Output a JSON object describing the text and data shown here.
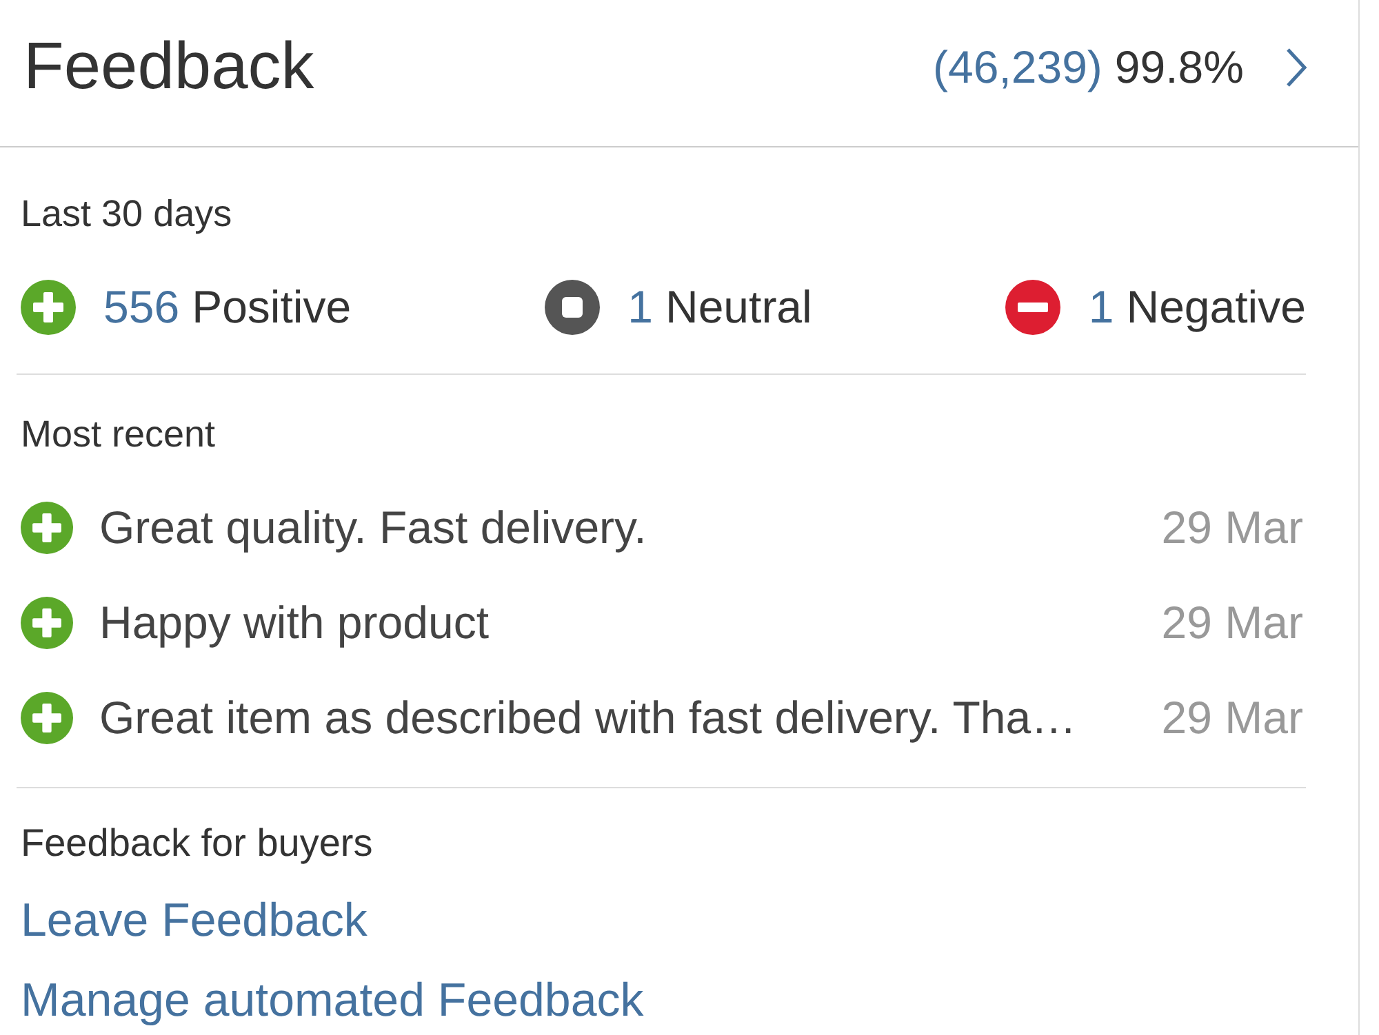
{
  "header": {
    "title": "Feedback",
    "count": "(46,239)",
    "percentage": "99.8%"
  },
  "summary": {
    "label": "Last 30 days",
    "ratings": [
      {
        "kind": "positive",
        "count": "556",
        "label": "Positive"
      },
      {
        "kind": "neutral",
        "count": "1",
        "label": "Neutral"
      },
      {
        "kind": "negative",
        "count": "1",
        "label": "Negative"
      }
    ]
  },
  "recent": {
    "label": "Most recent",
    "items": [
      {
        "kind": "positive",
        "text": "Great quality. Fast delivery.",
        "date": "29 Mar"
      },
      {
        "kind": "positive",
        "text": "Happy with product",
        "date": "29 Mar"
      },
      {
        "kind": "positive",
        "text": "Great item as described with fast delivery. Tha…",
        "date": "29 Mar"
      }
    ]
  },
  "buyers": {
    "label": "Feedback for buyers",
    "links": [
      "Leave Feedback",
      "Manage automated Feedback"
    ]
  }
}
